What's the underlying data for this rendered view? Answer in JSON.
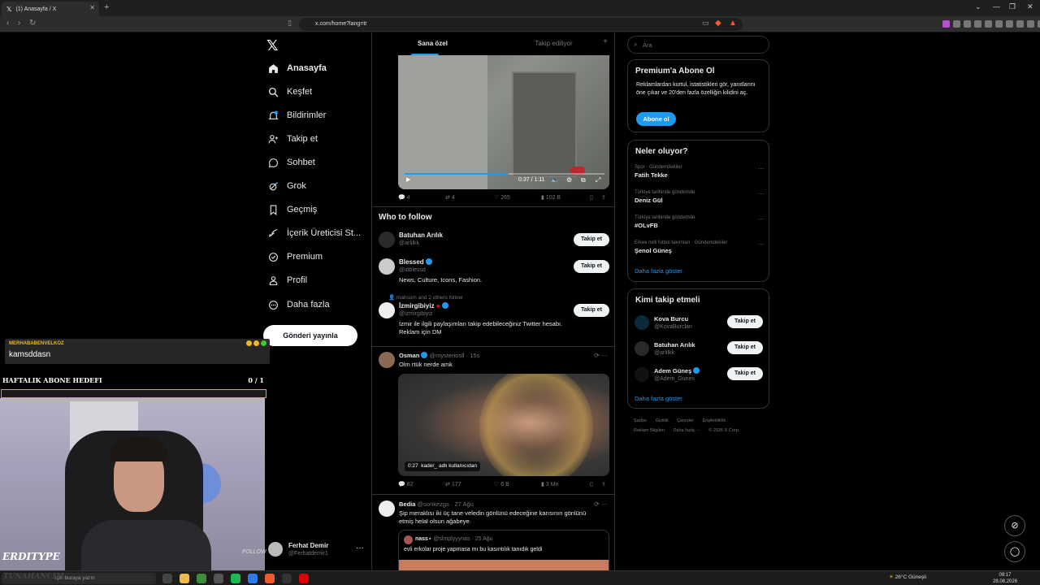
{
  "browser": {
    "tab_title": "(1) Anasayfa / X",
    "url": "x.com/home?lang=tr"
  },
  "nav": {
    "items": [
      {
        "label": "Anasayfa",
        "icon": "home-icon"
      },
      {
        "label": "Keşfet",
        "icon": "search-icon"
      },
      {
        "label": "Bildirimler",
        "icon": "bell-icon",
        "badge": "1"
      },
      {
        "label": "Takip et",
        "icon": "person-add-icon"
      },
      {
        "label": "Sohbet",
        "icon": "chat-icon"
      },
      {
        "label": "Grok",
        "icon": "grok-icon"
      },
      {
        "label": "Geçmiş",
        "icon": "bookmark-icon"
      },
      {
        "label": "İçerik Üreticisi St...",
        "icon": "rocket-icon"
      },
      {
        "label": "Premium",
        "icon": "premium-icon"
      },
      {
        "label": "Profil",
        "icon": "profile-icon"
      },
      {
        "label": "Daha fazla",
        "icon": "more-icon"
      }
    ],
    "post_button": "Gönderi yayınla",
    "account": {
      "name": "Ferhat Demir",
      "handle": "@Ferhatdemir1"
    }
  },
  "timeline": {
    "tabs": [
      "Sana özel",
      "Takip ediliyor"
    ],
    "video1": {
      "time": "0:37 / 1:11",
      "progress": 0.52
    },
    "actions1": {
      "replies": "4",
      "reposts": "4",
      "likes": "265",
      "views": "102 B"
    },
    "who_to_follow": {
      "title": "Who to follow",
      "users": [
        {
          "name": "Batuhan Arılık",
          "handle": "@arlilkk",
          "bio": "",
          "verified": false
        },
        {
          "name": "Blessed",
          "handle": "@idblessd",
          "bio": "News, Culture, Icons, Fashion.",
          "verified": true
        },
        {
          "name": "İzmirgibiyiz",
          "handle": "@izmirgibiyiz",
          "bio": "İzmir ile ilgili paylaşımları takip edebileceğiniz Twitter hesabı. Reklam için DM",
          "verified": true
        }
      ],
      "social_context": "mahsum and 2 others follow",
      "follow_label": "Takip et"
    },
    "tweet1": {
      "name": "Osman",
      "handle": "@mysteriosll",
      "time": "15s",
      "text": "Olm rtük nerde amk",
      "video_time": "0:27",
      "video_badge": "kader_ adlı kullanıcıdan",
      "replies": "82",
      "reposts": "177",
      "likes": "6 B",
      "views": "3 Mn"
    },
    "tweet2": {
      "name": "Bedia",
      "handle": "@sonkezgs",
      "time": "27 Ağu",
      "text": "Şip meraklısı iki üç tane veledin gönlünü edeceğine karısının gönlünü etmiş helal olsun ağabeye",
      "quote": {
        "name": "nass⋆",
        "handle": "@slmplyyynas",
        "time": "25 Ağu",
        "text": "evli erkolar proje yapmasa mı bu kasıntılık tanıdık geldi"
      }
    }
  },
  "sidebar": {
    "search_placeholder": "Ara",
    "premium": {
      "title": "Premium'a Abone Ol",
      "text": "Reklamlardan kurtul, istatistikleri gör, yanıtlarını öne çıkar ve 20'den fazla özelliğin kilidini aç.",
      "button": "Abone ol"
    },
    "trends": {
      "title": "Neler oluyor?",
      "items": [
        {
          "context": "Spor · Gündemdekiler",
          "name": "Fatih Tekke"
        },
        {
          "context": "Türkiye tarihinde gündemde",
          "name": "Deniz Gül"
        },
        {
          "context": "Türkiye tarihinde gündemde",
          "name": "#OLvFB"
        },
        {
          "context": "Erkek milli futbol takımları · Gündemdekiler",
          "name": "Şenol Güneş"
        }
      ],
      "show_more": "Daha fazla göster"
    },
    "who": {
      "title": "Kimi takip etmeli",
      "users": [
        {
          "name": "Kova Burcu",
          "handle": "@KovaBurclari",
          "verified": false
        },
        {
          "name": "Batuhan Arılık",
          "handle": "@arlilkk",
          "verified": false
        },
        {
          "name": "Adem Güneş",
          "handle": "@Adem_Gunes",
          "verified": true
        }
      ],
      "follow_label": "Takip et",
      "show_more": "Daha fazla göster"
    },
    "footer": [
      "Şartlar",
      "Gizlilik",
      "Çerezler",
      "Erişilebilirlik",
      "Reklam Bilgileri",
      "Daha fazla ···",
      "© 2026 X Corp."
    ]
  },
  "overlay": {
    "chat_user": "MERHABABENVELKOZ",
    "chat_msg": "kamsddasn",
    "sub_goal_label": "HAFTALIK ABONE HEDEFI",
    "sub_goal_count": "0 / 1",
    "sub_goal_progress": 0,
    "cam_name": "ERDITYPE",
    "cam_follow": "FOLLOW"
  },
  "taskbar": {
    "search_placeholder": "için buraya yazın",
    "taskbar_name": "TUNAHANCIM",
    "weather": "26°C  Güneşli",
    "time": "09:17",
    "date": "28.08.2026"
  },
  "colors": {
    "accent": "#1d9bf0",
    "bg": "#000000",
    "border": "#2f3336"
  }
}
